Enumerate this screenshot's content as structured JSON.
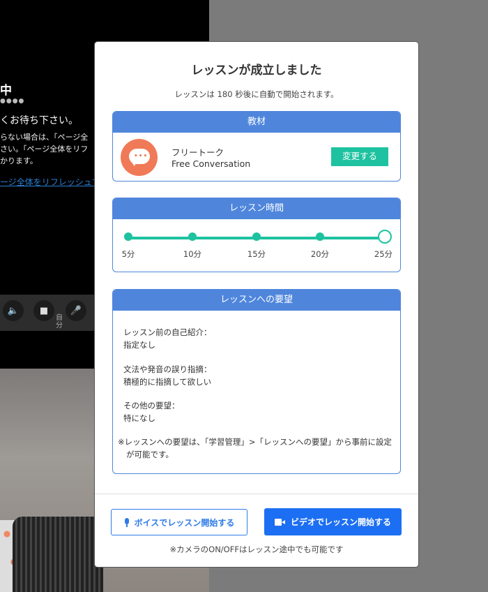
{
  "background": {
    "status_fragment": "中",
    "dots": "●●●●",
    "wait_text": "くお待ち下さい。",
    "note_lines": [
      "らない場合は、「ページ全",
      "さい。「ページ全体をリフ",
      "かります。"
    ],
    "link_text": "ージ全体をリフレッシュす",
    "control_label": "自分"
  },
  "modal": {
    "title": "レッスンが成立しました",
    "subtitle": "レッスンは 180 秒後に自動で開始されます。",
    "material": {
      "header": "教材",
      "name_jp": "フリートーク",
      "name_en": "Free Conversation",
      "change_label": "変更する",
      "icon": "speech-bubble-icon"
    },
    "lesson_time": {
      "header": "レッスン時間",
      "options": [
        "5分",
        "10分",
        "15分",
        "20分",
        "25分"
      ],
      "selected": "25分"
    },
    "requests": {
      "header": "レッスンへの要望",
      "items": [
        {
          "question": "レッスン前の自己紹介：",
          "answer": "指定なし"
        },
        {
          "question": "文法や発音の誤り指摘：",
          "answer": "積極的に指摘して欲しい"
        },
        {
          "question": "その他の要望：",
          "answer": "特になし"
        }
      ],
      "note_line1": "※レッスンへの要望は、「学習管理」>「レッスンへの要望」から事前に設定",
      "note_line2": "が可能です。"
    },
    "voice_button": "ボイスでレッスン開始する",
    "video_button": "ビデオでレッスン開始する",
    "footnote": "※カメラのON/OFFはレッスン途中でも可能です"
  }
}
